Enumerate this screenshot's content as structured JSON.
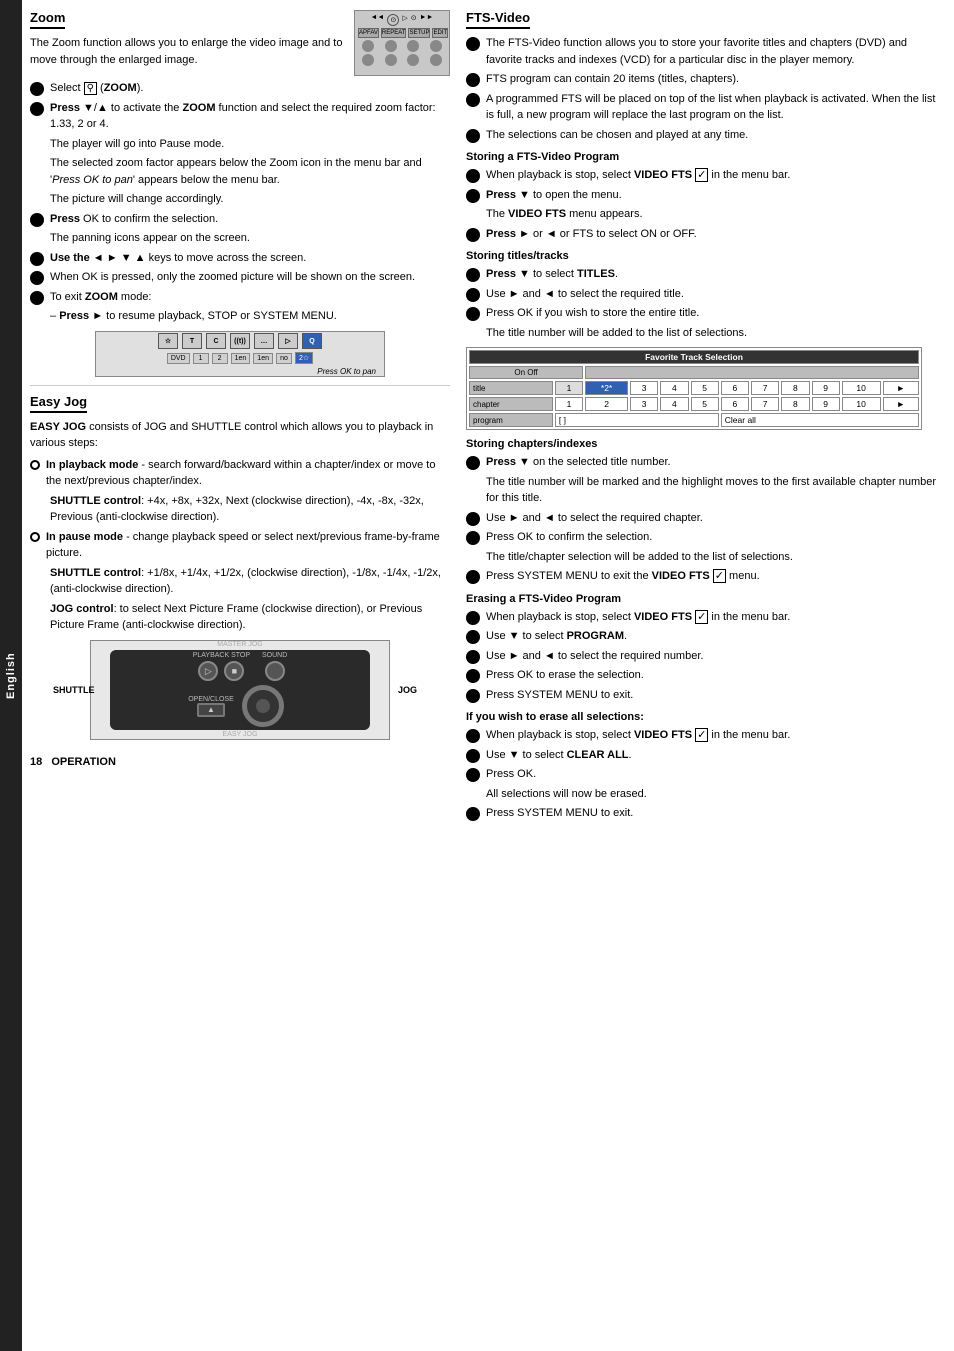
{
  "page": {
    "language_tab": "English",
    "page_number": "18",
    "page_label": "Operation"
  },
  "zoom_section": {
    "title": "Zoom",
    "intro": "The Zoom function allows you to enlarge the video image and to move through the enlarged image.",
    "bullets": [
      {
        "type": "filled",
        "text": "Select  (ZOOM)."
      },
      {
        "type": "filled",
        "text": "Press ▼/▲ to activate the ZOOM function and select the required zoom factor: 1.33, 2 or 4."
      },
      {
        "type": "indent",
        "text": "The player will go into Pause mode."
      },
      {
        "type": "indent",
        "text": "The selected zoom factor appears below the Zoom icon in the menu bar and 'Press OK to pan' appears below the menu bar."
      },
      {
        "type": "indent",
        "text": "The picture will change accordingly."
      },
      {
        "type": "filled",
        "text": "Press OK to confirm the selection."
      },
      {
        "type": "indent",
        "text": "The panning icons appear on the screen."
      },
      {
        "type": "filled",
        "text": "Use the ◄ ► ▼ ▲ keys to move across the screen."
      },
      {
        "type": "filled",
        "text": "When OK is pressed, only the zoomed picture will be shown on the screen."
      },
      {
        "type": "filled",
        "text": "To exit ZOOM mode:"
      },
      {
        "type": "indent",
        "text": "– Press ► to resume playback, STOP or SYSTEM MENU."
      }
    ],
    "menu_bar": {
      "icons": [
        "T",
        "C",
        "(t)",
        "(...)",
        "▷",
        "Q"
      ],
      "cells": [
        "DVD",
        "1",
        "2",
        "1en",
        "1en",
        "no",
        "2☆"
      ],
      "press_ok": "Press OK to pan"
    }
  },
  "easy_jog_section": {
    "title": "Easy Jog",
    "intro_bold": "EASY JOG",
    "intro": " consists of JOG and SHUTTLE control which allows you to playback in various steps:",
    "in_playback_bold": "In playback mode",
    "in_playback": " - search forward/backward within a chapter/index or move to the next/previous chapter/index.",
    "shuttle_control1_bold": "SHUTTLE control",
    "shuttle_control1": ": +4x, +8x, +32x, Next (clockwise direction), -4x, -8x, -32x, Previous (anti-clockwise direction).",
    "in_pause_bold": "In pause mode",
    "in_pause": " - change playback speed or select next/previous frame-by-frame picture.",
    "shuttle_control2_bold": "SHUTTLE control",
    "shuttle_control2": ": +1/8x, +1/4x, +1/2x, (clockwise direction), -1/8x, -1/4x, -1/2x, (anti-clockwise direction).",
    "jog_control_bold": "JOG control",
    "jog_control": ": to select Next Picture Frame (clockwise direction), or Previous Picture Frame (anti-clockwise direction).",
    "shuttle_label": "SHUTTLE",
    "jog_label": "JOG"
  },
  "fts_section": {
    "title": "FTS-Video",
    "bullets": [
      "The FTS-Video function allows you to store your favorite titles and chapters (DVD) and favorite tracks and indexes (VCD) for a particular disc in the player memory.",
      "FTS program can contain 20 items (titles, chapters).",
      "A programmed FTS will be placed on top of the list when playback is activated. When the list is full, a new program will replace the last program on the list.",
      "The selections can be chosen and played at any time."
    ],
    "storing_program": {
      "title": "Storing a FTS-Video Program",
      "bullets": [
        "When playback is stop, select VIDEO FTS ✓ in the menu bar.",
        "Press ▼ to open the menu.",
        "The VIDEO FTS menu appears.",
        "Press ► or ◄ or FTS to select ON or OFF."
      ]
    },
    "storing_titles": {
      "title": "Storing titles/tracks",
      "bullets": [
        "Press ▼ to select TITLES.",
        "Use ► and ◄ to select the required title.",
        "Press OK if you wish to store the entire title.",
        "The title number will be added to the list of selections."
      ],
      "table": {
        "header": "Favorite Track Selection",
        "on_off_label": "On  Off",
        "rows": [
          {
            "label": "title",
            "cells": [
              "1",
              "*2*",
              "3",
              "4",
              "5",
              "6",
              "7",
              "8",
              "9",
              "10 ►"
            ]
          },
          {
            "label": "chapter",
            "cells": [
              "1",
              "2",
              "3",
              "4",
              "5",
              "6",
              "7",
              "8",
              "9",
              "10 ►"
            ]
          },
          {
            "label": "program",
            "cells": [
              "[ ]",
              "Clear all"
            ]
          }
        ]
      }
    },
    "storing_chapters": {
      "title": "Storing chapters/indexes",
      "bullets": [
        "Press ▼ on the selected title number.",
        "The title number will be marked and the highlight moves to the first available chapter number for this title.",
        "Use ► and ◄ to select the required chapter.",
        "Press OK to confirm the selection.",
        "The title/chapter selection will be added to the list of selections.",
        "Press SYSTEM MENU to exit the VIDEO FTS ✓ menu."
      ]
    },
    "erasing_program": {
      "title": "Erasing a FTS-Video Program",
      "bullets": [
        "When playback is stop, select VIDEO FTS ✓ in the menu bar.",
        "Use ▼ to select PROGRAM.",
        "Use ► and ◄ to select the required number.",
        "Press OK to erase the selection.",
        "Press SYSTEM MENU to exit."
      ]
    },
    "erase_all": {
      "title": "If you wish to erase all selections:",
      "bullets": [
        "When playback is stop, select VIDEO FTS ✓ in the menu bar.",
        "Use ▼ to select CLEAR ALL.",
        "Press OK.",
        "All selections will now be erased.",
        "Press SYSTEM MENU to exit."
      ]
    }
  }
}
